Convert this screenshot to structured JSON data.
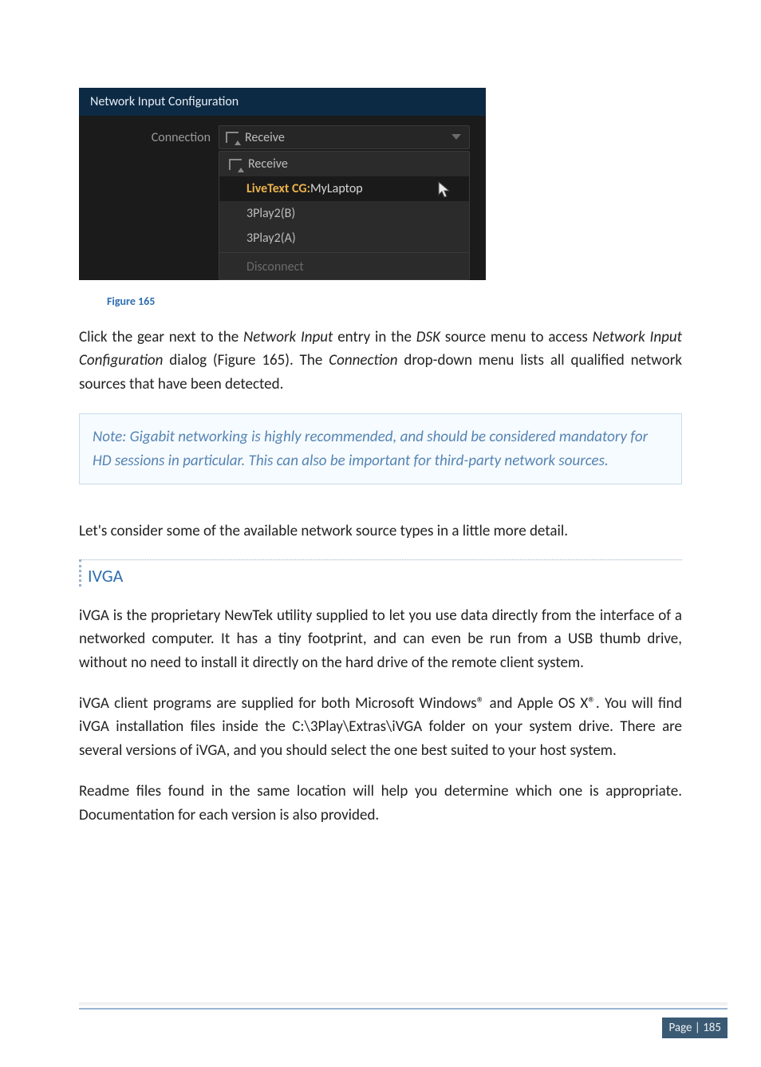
{
  "dialog": {
    "title": "Network Input Configuration",
    "label_connection": "Connection",
    "selected": "Receive",
    "options": {
      "receive": "Receive",
      "live_prefix": "LiveText CG: ",
      "live_suffix": "MyLaptop",
      "op3b": "3Play2(B)",
      "op3a": "3Play2(A)",
      "disconnect": "Disconnect"
    }
  },
  "caption": "Figure 165",
  "para1": {
    "t1": "Click the gear next to the ",
    "i1": "Network Input",
    "t2": " entry in the ",
    "i2": "DSK",
    "t3": " source menu to access ",
    "i3": "Network Input Configuration",
    "t4": " dialog (Figure 165).   The ",
    "i4": "Connection",
    "t5": " drop-down menu lists all qualified network sources that have been detected."
  },
  "note": "Note: Gigabit networking is highly recommended, and should be considered mandatory for HD sessions in particular. This can also be important for third-party network sources.",
  "para2": "Let's consider some of the available network source types in a little more detail.",
  "section": "IVGA",
  "para3": "iVGA is the proprietary NewTek utility supplied to let you use data directly from the interface of a networked computer.  It has a tiny footprint, and can even be run from a USB thumb drive, without no need to install it directly on the hard drive of the remote client system.",
  "para4": "iVGA client programs are supplied for both Microsoft Windows® and Apple OS X®.  You will find iVGA installation files inside the C:\\3Play\\Extras\\iVGA folder on your system drive.  There are several versions of iVGA, and you should select the one best suited to your host system.",
  "para5": "Readme files found in the same location will help you determine which one is appropriate.  Documentation for each version is also provided.",
  "footer": {
    "label": "Page | ",
    "num": "185"
  }
}
